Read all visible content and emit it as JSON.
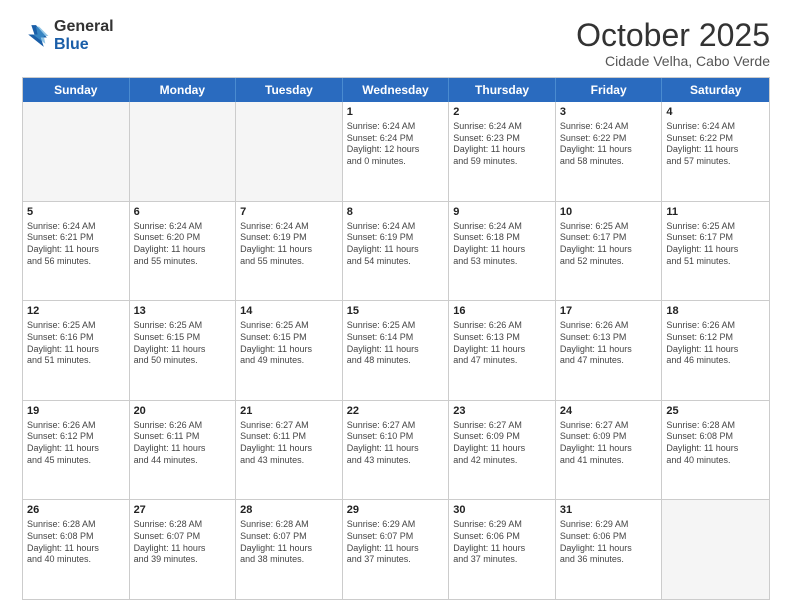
{
  "logo": {
    "general": "General",
    "blue": "Blue"
  },
  "title": "October 2025",
  "subtitle": "Cidade Velha, Cabo Verde",
  "header_days": [
    "Sunday",
    "Monday",
    "Tuesday",
    "Wednesday",
    "Thursday",
    "Friday",
    "Saturday"
  ],
  "weeks": [
    [
      {
        "day": "",
        "info": "",
        "empty": true
      },
      {
        "day": "",
        "info": "",
        "empty": true
      },
      {
        "day": "",
        "info": "",
        "empty": true
      },
      {
        "day": "1",
        "info": "Sunrise: 6:24 AM\nSunset: 6:24 PM\nDaylight: 12 hours\nand 0 minutes."
      },
      {
        "day": "2",
        "info": "Sunrise: 6:24 AM\nSunset: 6:23 PM\nDaylight: 11 hours\nand 59 minutes."
      },
      {
        "day": "3",
        "info": "Sunrise: 6:24 AM\nSunset: 6:22 PM\nDaylight: 11 hours\nand 58 minutes."
      },
      {
        "day": "4",
        "info": "Sunrise: 6:24 AM\nSunset: 6:22 PM\nDaylight: 11 hours\nand 57 minutes."
      }
    ],
    [
      {
        "day": "5",
        "info": "Sunrise: 6:24 AM\nSunset: 6:21 PM\nDaylight: 11 hours\nand 56 minutes."
      },
      {
        "day": "6",
        "info": "Sunrise: 6:24 AM\nSunset: 6:20 PM\nDaylight: 11 hours\nand 55 minutes."
      },
      {
        "day": "7",
        "info": "Sunrise: 6:24 AM\nSunset: 6:19 PM\nDaylight: 11 hours\nand 55 minutes."
      },
      {
        "day": "8",
        "info": "Sunrise: 6:24 AM\nSunset: 6:19 PM\nDaylight: 11 hours\nand 54 minutes."
      },
      {
        "day": "9",
        "info": "Sunrise: 6:24 AM\nSunset: 6:18 PM\nDaylight: 11 hours\nand 53 minutes."
      },
      {
        "day": "10",
        "info": "Sunrise: 6:25 AM\nSunset: 6:17 PM\nDaylight: 11 hours\nand 52 minutes."
      },
      {
        "day": "11",
        "info": "Sunrise: 6:25 AM\nSunset: 6:17 PM\nDaylight: 11 hours\nand 51 minutes."
      }
    ],
    [
      {
        "day": "12",
        "info": "Sunrise: 6:25 AM\nSunset: 6:16 PM\nDaylight: 11 hours\nand 51 minutes."
      },
      {
        "day": "13",
        "info": "Sunrise: 6:25 AM\nSunset: 6:15 PM\nDaylight: 11 hours\nand 50 minutes."
      },
      {
        "day": "14",
        "info": "Sunrise: 6:25 AM\nSunset: 6:15 PM\nDaylight: 11 hours\nand 49 minutes."
      },
      {
        "day": "15",
        "info": "Sunrise: 6:25 AM\nSunset: 6:14 PM\nDaylight: 11 hours\nand 48 minutes."
      },
      {
        "day": "16",
        "info": "Sunrise: 6:26 AM\nSunset: 6:13 PM\nDaylight: 11 hours\nand 47 minutes."
      },
      {
        "day": "17",
        "info": "Sunrise: 6:26 AM\nSunset: 6:13 PM\nDaylight: 11 hours\nand 47 minutes."
      },
      {
        "day": "18",
        "info": "Sunrise: 6:26 AM\nSunset: 6:12 PM\nDaylight: 11 hours\nand 46 minutes."
      }
    ],
    [
      {
        "day": "19",
        "info": "Sunrise: 6:26 AM\nSunset: 6:12 PM\nDaylight: 11 hours\nand 45 minutes."
      },
      {
        "day": "20",
        "info": "Sunrise: 6:26 AM\nSunset: 6:11 PM\nDaylight: 11 hours\nand 44 minutes."
      },
      {
        "day": "21",
        "info": "Sunrise: 6:27 AM\nSunset: 6:11 PM\nDaylight: 11 hours\nand 43 minutes."
      },
      {
        "day": "22",
        "info": "Sunrise: 6:27 AM\nSunset: 6:10 PM\nDaylight: 11 hours\nand 43 minutes."
      },
      {
        "day": "23",
        "info": "Sunrise: 6:27 AM\nSunset: 6:09 PM\nDaylight: 11 hours\nand 42 minutes."
      },
      {
        "day": "24",
        "info": "Sunrise: 6:27 AM\nSunset: 6:09 PM\nDaylight: 11 hours\nand 41 minutes."
      },
      {
        "day": "25",
        "info": "Sunrise: 6:28 AM\nSunset: 6:08 PM\nDaylight: 11 hours\nand 40 minutes."
      }
    ],
    [
      {
        "day": "26",
        "info": "Sunrise: 6:28 AM\nSunset: 6:08 PM\nDaylight: 11 hours\nand 40 minutes."
      },
      {
        "day": "27",
        "info": "Sunrise: 6:28 AM\nSunset: 6:07 PM\nDaylight: 11 hours\nand 39 minutes."
      },
      {
        "day": "28",
        "info": "Sunrise: 6:28 AM\nSunset: 6:07 PM\nDaylight: 11 hours\nand 38 minutes."
      },
      {
        "day": "29",
        "info": "Sunrise: 6:29 AM\nSunset: 6:07 PM\nDaylight: 11 hours\nand 37 minutes."
      },
      {
        "day": "30",
        "info": "Sunrise: 6:29 AM\nSunset: 6:06 PM\nDaylight: 11 hours\nand 37 minutes."
      },
      {
        "day": "31",
        "info": "Sunrise: 6:29 AM\nSunset: 6:06 PM\nDaylight: 11 hours\nand 36 minutes."
      },
      {
        "day": "",
        "info": "",
        "empty": true
      }
    ]
  ]
}
